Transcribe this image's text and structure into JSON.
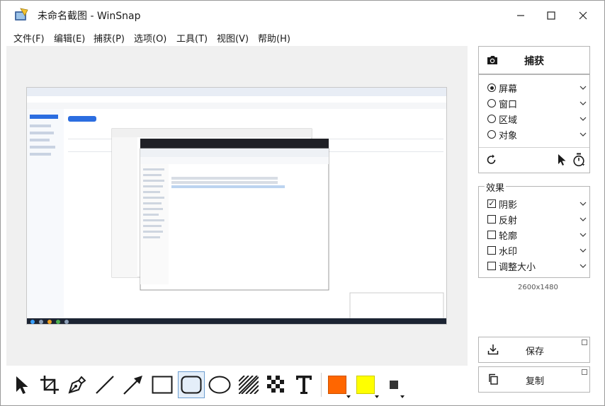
{
  "window": {
    "title": "未命名截图 - WinSnap",
    "app_icon": "winsnap-logo-icon",
    "controls": [
      "minimize-icon",
      "maximize-icon",
      "close-icon"
    ]
  },
  "menu": {
    "items": [
      "文件(F)",
      "编辑(E)",
      "捕获(P)",
      "选项(O)",
      "工具(T)",
      "视图(V)",
      "帮助(H)"
    ]
  },
  "capture": {
    "label": "捕获",
    "icon": "camera-icon"
  },
  "modes": [
    {
      "label": "屏幕",
      "selected": true
    },
    {
      "label": "窗口",
      "selected": false
    },
    {
      "label": "区域",
      "selected": false
    },
    {
      "label": "对象",
      "selected": false
    }
  ],
  "mode_tools": [
    "redo-icon",
    "cursor-icon",
    "timer-icon"
  ],
  "effects": {
    "title": "效果",
    "items": [
      {
        "label": "阴影",
        "checked": true
      },
      {
        "label": "反射",
        "checked": false
      },
      {
        "label": "轮廓",
        "checked": false
      },
      {
        "label": "水印",
        "checked": false
      },
      {
        "label": "调整大小",
        "checked": false
      }
    ]
  },
  "dimensions": "2600x1480",
  "actions": {
    "save_label": "保存",
    "copy_label": "复制"
  },
  "toolbar": {
    "tools": [
      "pointer-icon",
      "crop-icon",
      "pen-icon",
      "line-icon",
      "arrow-icon",
      "rectangle-icon",
      "rounded-rectangle-icon",
      "ellipse-icon",
      "hatch-icon",
      "pixelate-icon",
      "text-icon"
    ],
    "selected_tool": "rounded-rectangle-icon",
    "primary_color": "#ff6600",
    "secondary_color": "#ffff00",
    "line_width_icon": "line-width-icon"
  }
}
